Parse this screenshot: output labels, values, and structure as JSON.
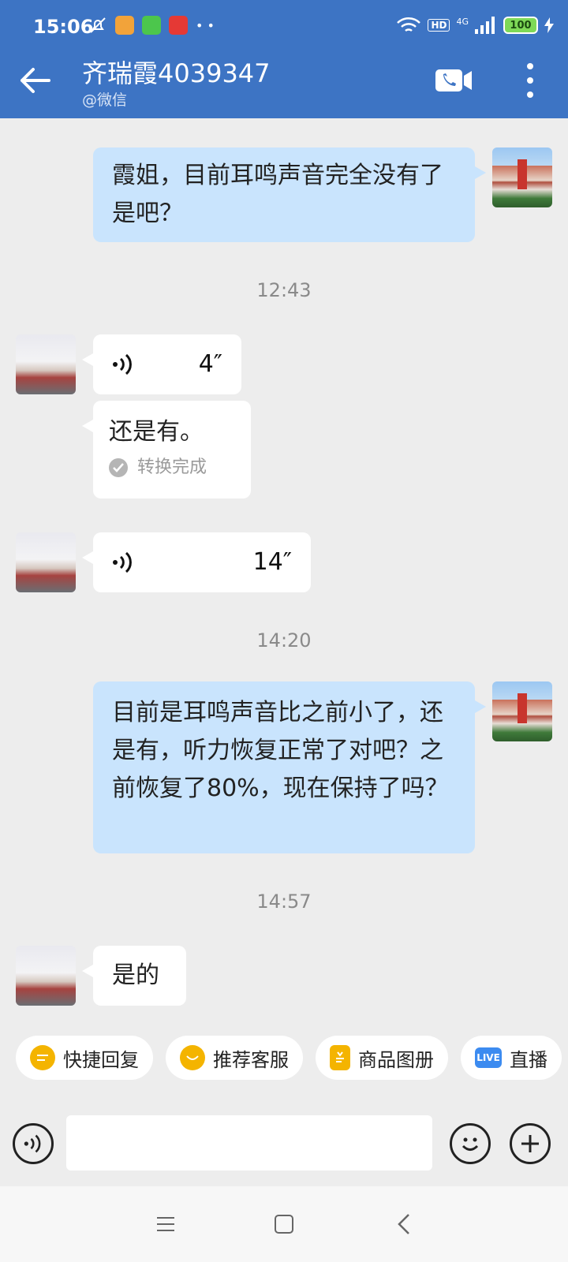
{
  "status": {
    "time": "15:06",
    "network": "4G",
    "hd": "HD",
    "battery": "100"
  },
  "header": {
    "title": "齐瑞霞4039347",
    "subtitle": "@微信"
  },
  "messages": {
    "m1": "霞姐，目前耳鸣声音完全没有了是吧？",
    "t1": "12:43",
    "v1_duration": "4″",
    "v1_transcript": "还是有。",
    "v1_status": "转换完成",
    "v2_duration": "14″",
    "t2": "14:20",
    "m2": "目前是耳鸣声音比之前小了，还是有，听力恢复正常了对吧？之前恢复了80%，现在保持了吗？",
    "t3": "14:57",
    "m3": "是的"
  },
  "quick": {
    "c1": "快捷回复",
    "c2": "推荐客服",
    "c3": "商品图册",
    "c4": "直播",
    "live_badge": "LIVE"
  },
  "input": {
    "placeholder": ""
  },
  "colors": {
    "header": "#3d74c4",
    "my_bubble": "#c9e4fd",
    "their_bubble": "#ffffff",
    "background": "#ededed"
  },
  "icons": [
    "back-arrow-icon",
    "video-call-icon",
    "more-icon",
    "voice-wave-icon",
    "check-icon",
    "emoji-icon",
    "plus-icon",
    "menu-icon",
    "home-icon",
    "back-nav-icon"
  ]
}
